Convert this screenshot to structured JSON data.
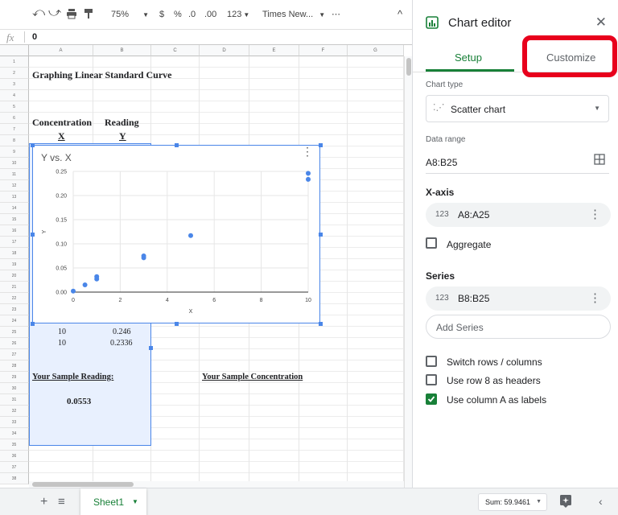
{
  "toolbar": {
    "zoom": "75%",
    "currency": "$",
    "percent": "%",
    "dec_less": ".0",
    "dec_more": ".00",
    "number_format": "123",
    "font": "Times New...",
    "more": "⋯"
  },
  "formula_bar": {
    "fx": "fx",
    "value": "0"
  },
  "columns": [
    "A",
    "B",
    "C",
    "D",
    "E",
    "F",
    "G"
  ],
  "rows": [
    "1",
    "2",
    "3",
    "4",
    "5",
    "6",
    "7",
    "8",
    "9",
    "10",
    "11",
    "12",
    "13",
    "14",
    "15",
    "16",
    "17",
    "18",
    "19",
    "20",
    "21",
    "22",
    "23",
    "24",
    "25",
    "26",
    "27",
    "28",
    "29",
    "30",
    "31",
    "32",
    "33",
    "34",
    "35",
    "36",
    "37",
    "38"
  ],
  "cells": {
    "title": "Graphing Linear Standard Curve",
    "col_a_header": "Concentration",
    "col_b_header": "Reading",
    "col_a_sub": "X",
    "col_b_sub": "Y",
    "r24_a": "10",
    "r24_b": "0.246",
    "r25_a": "10",
    "r25_b": "0.2336",
    "sample_reading_label": "Your Sample Reading:",
    "sample_conc_label": "Your Sample Concentration",
    "sample_reading_value": "0.0553"
  },
  "chart_data": {
    "type": "scatter",
    "title": "Y vs. X",
    "xlabel": "X",
    "ylabel": "Y",
    "xlim": [
      0,
      10
    ],
    "ylim": [
      0,
      0.25
    ],
    "xticks": [
      "0",
      "2",
      "4",
      "6",
      "8",
      "10"
    ],
    "yticks": [
      "0.00",
      "0.05",
      "0.10",
      "0.15",
      "0.20",
      "0.25"
    ],
    "color": "#4a86e8",
    "grid": true,
    "points": [
      {
        "x": 0,
        "y": 0.002
      },
      {
        "x": 0.5,
        "y": 0.015
      },
      {
        "x": 1,
        "y": 0.027
      },
      {
        "x": 1,
        "y": 0.032
      },
      {
        "x": 3,
        "y": 0.071
      },
      {
        "x": 3,
        "y": 0.075
      },
      {
        "x": 5,
        "y": 0.117
      },
      {
        "x": 10,
        "y": 0.246
      },
      {
        "x": 10,
        "y": 0.2336
      }
    ]
  },
  "bottom": {
    "sheet_name": "Sheet1",
    "sum": "Sum: 59.9461"
  },
  "panel": {
    "title": "Chart editor",
    "tab_setup": "Setup",
    "tab_customize": "Customize",
    "highlight_color": "#e8001c",
    "chart_type_label": "Chart type",
    "chart_type_value": "Scatter chart",
    "data_range_label": "Data range",
    "data_range_value": "A8:B25",
    "xaxis_heading": "X-axis",
    "xaxis_range": "A8:A25",
    "xaxis_prefix": "123",
    "aggregate_label": "Aggregate",
    "series_heading": "Series",
    "series_range": "B8:B25",
    "series_prefix": "123",
    "add_series": "Add Series",
    "opt_switch": "Switch rows / columns",
    "opt_row_headers": "Use row 8 as headers",
    "opt_col_labels": "Use column A as labels"
  }
}
